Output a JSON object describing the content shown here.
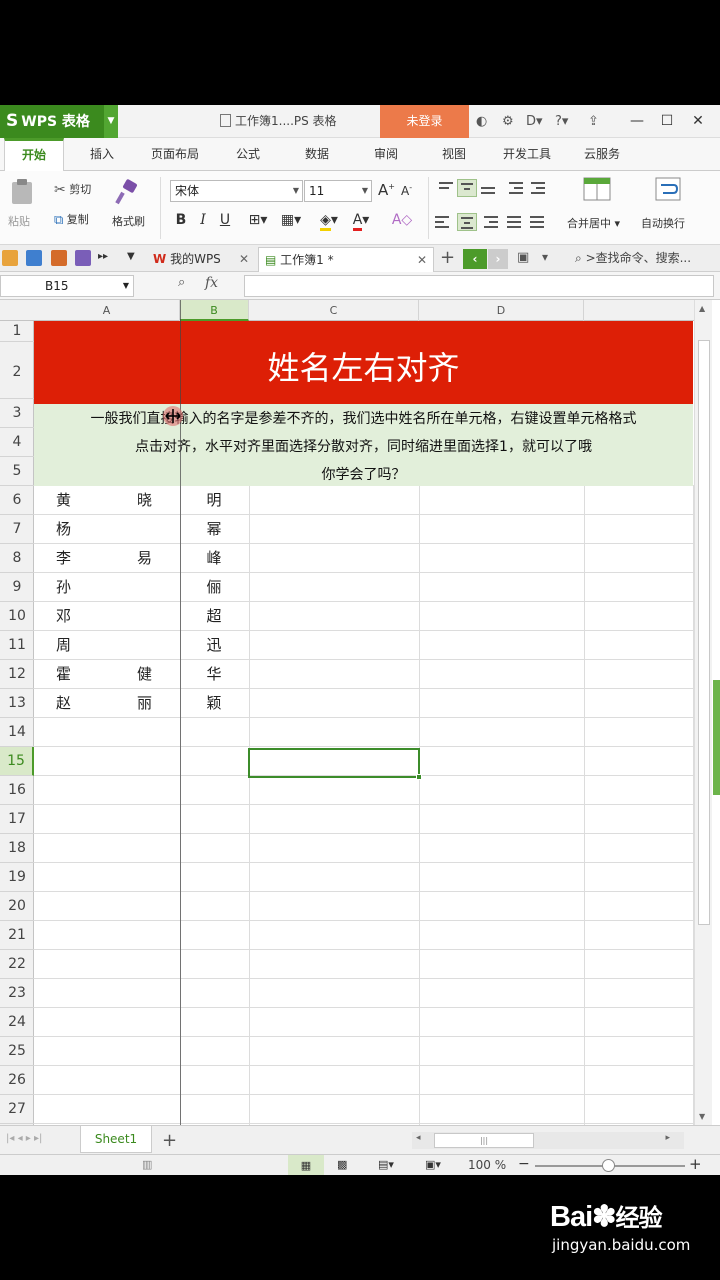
{
  "window": {
    "app_name": "WPS 表格",
    "doc_title": "工作簿1....PS 表格",
    "login_label": "未登录"
  },
  "menu": {
    "tabs": [
      "开始",
      "插入",
      "页面布局",
      "公式",
      "数据",
      "审阅",
      "视图",
      "开发工具",
      "云服务"
    ],
    "active": "开始"
  },
  "ribbon": {
    "paste": "粘贴",
    "cut": "剪切",
    "copy": "复制",
    "format_painter": "格式刷",
    "font_name": "宋体",
    "font_size": "11",
    "bold": "B",
    "italic": "I",
    "underline": "U",
    "merge_center": "合并居中",
    "wrap_text": "自动换行"
  },
  "doc_tabs": {
    "my_wps": "我的WPS",
    "workbook": "工作簿1 *",
    "search_cmd": ">查找命令、搜索..."
  },
  "formula_bar": {
    "name_box": "B15",
    "fx": "fx"
  },
  "grid": {
    "columns": [
      "A",
      "B",
      "C",
      "D"
    ],
    "rows": [
      "1",
      "2",
      "3",
      "4",
      "5",
      "6",
      "7",
      "8",
      "9",
      "10",
      "11",
      "12",
      "13",
      "14",
      "15",
      "16",
      "17",
      "18",
      "19",
      "20",
      "21",
      "22",
      "23",
      "24",
      "25",
      "26",
      "27"
    ],
    "title_cell": "姓名左右对齐",
    "description_lines": [
      "一般我们直接输入的名字是参差不齐的，我们选中姓名所在单元格，右键设置单元格格式",
      "点击对齐，水平对齐里面选择分散对齐，同时缩进里面选择1，就可以了哦",
      "你学会了吗？"
    ],
    "names": [
      {
        "a1": "黄",
        "a2": "晓",
        "b": "明"
      },
      {
        "a1": "杨",
        "a2": "",
        "b": "幂"
      },
      {
        "a1": "李",
        "a2": "易",
        "b": "峰"
      },
      {
        "a1": "孙",
        "a2": "",
        "b": "俪"
      },
      {
        "a1": "邓",
        "a2": "",
        "b": "超"
      },
      {
        "a1": "周",
        "a2": "",
        "b": "迅"
      },
      {
        "a1": "霍",
        "a2": "健",
        "b": "华"
      },
      {
        "a1": "赵",
        "a2": "丽",
        "b": "颖"
      }
    ],
    "selected_cell": "B15"
  },
  "sheets": {
    "tabs": [
      "Sheet1"
    ],
    "add": "+"
  },
  "status": {
    "zoom": "100 %"
  },
  "watermark": {
    "brand": "Bai",
    "brand_cn": "经验",
    "site": "jingyan.baidu.com"
  },
  "colors": {
    "brand_green": "#3b8a1e",
    "title_red": "#dd1f06",
    "desc_green": "#e2efda",
    "login_orange": "#ec7a4a"
  }
}
